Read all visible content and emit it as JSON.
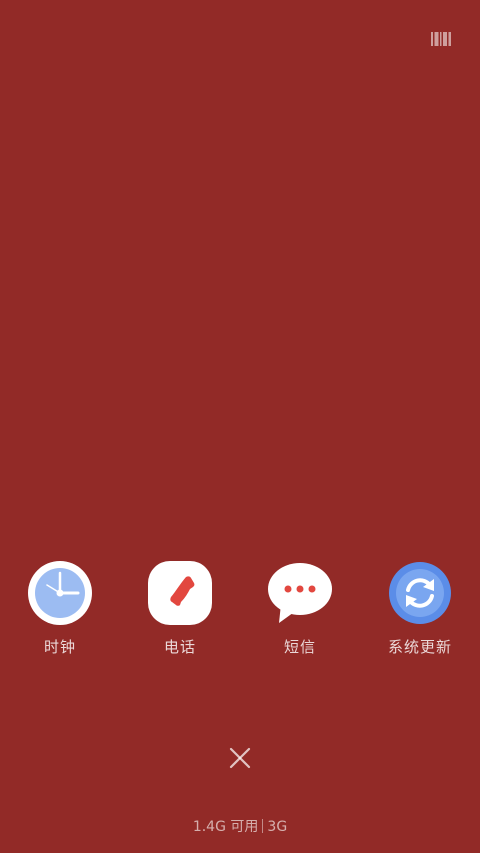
{
  "apps": [
    {
      "label": "时钟",
      "icon": "clock-icon"
    },
    {
      "label": "电话",
      "icon": "phone-icon"
    },
    {
      "label": "短信",
      "icon": "message-icon"
    },
    {
      "label": "系统更新",
      "icon": "system-update-icon"
    }
  ],
  "top_right_icon": "barcode-icon",
  "close_icon": "close-icon",
  "status": {
    "storage": "1.4G 可用",
    "network": "3G"
  },
  "colors": {
    "background": "#922a27",
    "clock_face": "#9cbcf2",
    "phone_handset": "#e2473f",
    "update_blue": "#5b8de8"
  }
}
